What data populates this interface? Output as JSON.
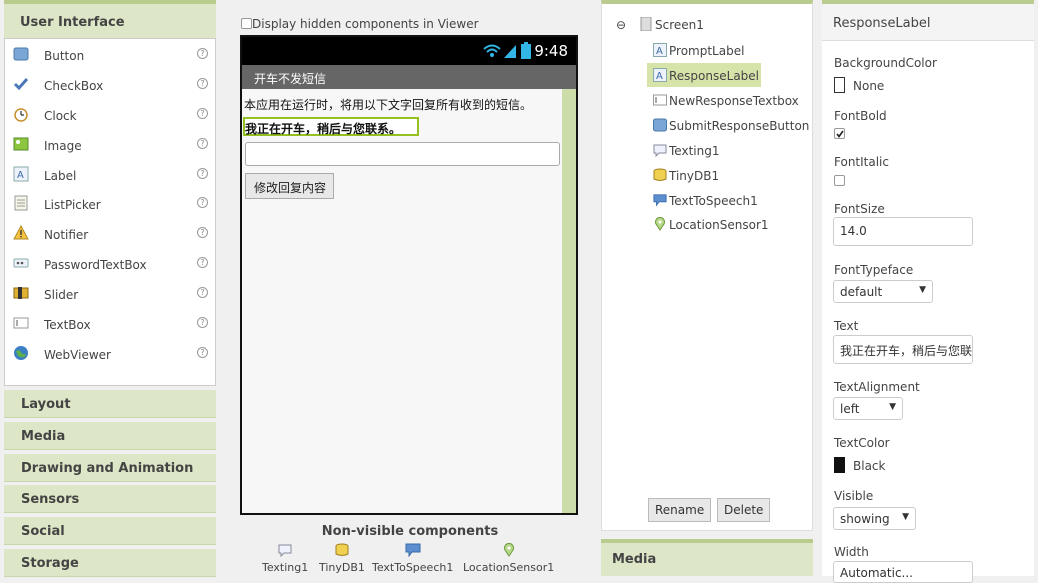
{
  "palette": {
    "header": "User Interface",
    "items": [
      {
        "label": "Button",
        "icon": "button-icon"
      },
      {
        "label": "CheckBox",
        "icon": "checkbox-icon"
      },
      {
        "label": "Clock",
        "icon": "clock-icon"
      },
      {
        "label": "Image",
        "icon": "image-icon"
      },
      {
        "label": "Label",
        "icon": "label-icon"
      },
      {
        "label": "ListPicker",
        "icon": "listpicker-icon"
      },
      {
        "label": "Notifier",
        "icon": "notifier-icon"
      },
      {
        "label": "PasswordTextBox",
        "icon": "password-icon"
      },
      {
        "label": "Slider",
        "icon": "slider-icon"
      },
      {
        "label": "TextBox",
        "icon": "textbox-icon"
      },
      {
        "label": "WebViewer",
        "icon": "webviewer-icon"
      }
    ],
    "help_glyph": "?",
    "categories": [
      "Layout",
      "Media",
      "Drawing and Animation",
      "Sensors",
      "Social",
      "Storage"
    ]
  },
  "viewer": {
    "hidden_checkbox_label": "Display hidden components in Viewer",
    "status_time": "9:48",
    "title": "开车不发短信",
    "prompt_label": "本应用在运行时，将用以下文字回复所有收到的短信。",
    "response_label": "我正在开车，稍后与您联系。",
    "button_label": "修改回复内容",
    "nonvisible_title": "Non-visible components",
    "nonvisible": [
      "Texting1",
      "TinyDB1",
      "TextToSpeech1",
      "LocationSensor1"
    ]
  },
  "components": {
    "root": "Screen1",
    "collapse_glyph": "⊖",
    "items": [
      "PromptLabel",
      "ResponseLabel",
      "NewResponseTextbox",
      "SubmitResponseButton",
      "Texting1",
      "TinyDB1",
      "TextToSpeech1",
      "LocationSensor1"
    ],
    "rename_label": "Rename",
    "delete_label": "Delete",
    "media_header": "Media"
  },
  "properties": {
    "title": "ResponseLabel",
    "background_color_name": "BackgroundColor",
    "background_color_value": "None",
    "fontbold_name": "FontBold",
    "fontbold_checked": true,
    "fontitalic_name": "FontItalic",
    "fontitalic_checked": false,
    "fontsize_name": "FontSize",
    "fontsize_value": "14.0",
    "fonttypeface_name": "FontTypeface",
    "fonttypeface_value": "default",
    "text_name": "Text",
    "text_value": "我正在开车，稍后与您联",
    "textalign_name": "TextAlignment",
    "textalign_value": "left",
    "textcolor_name": "TextColor",
    "textcolor_value": "Black",
    "visible_name": "Visible",
    "visible_value": "showing",
    "width_name": "Width",
    "width_value": "Automatic..."
  },
  "colors": {
    "accent": "#94c11f",
    "header_bg": "#dde7c7",
    "selected_bg": "#d6e4a9"
  }
}
